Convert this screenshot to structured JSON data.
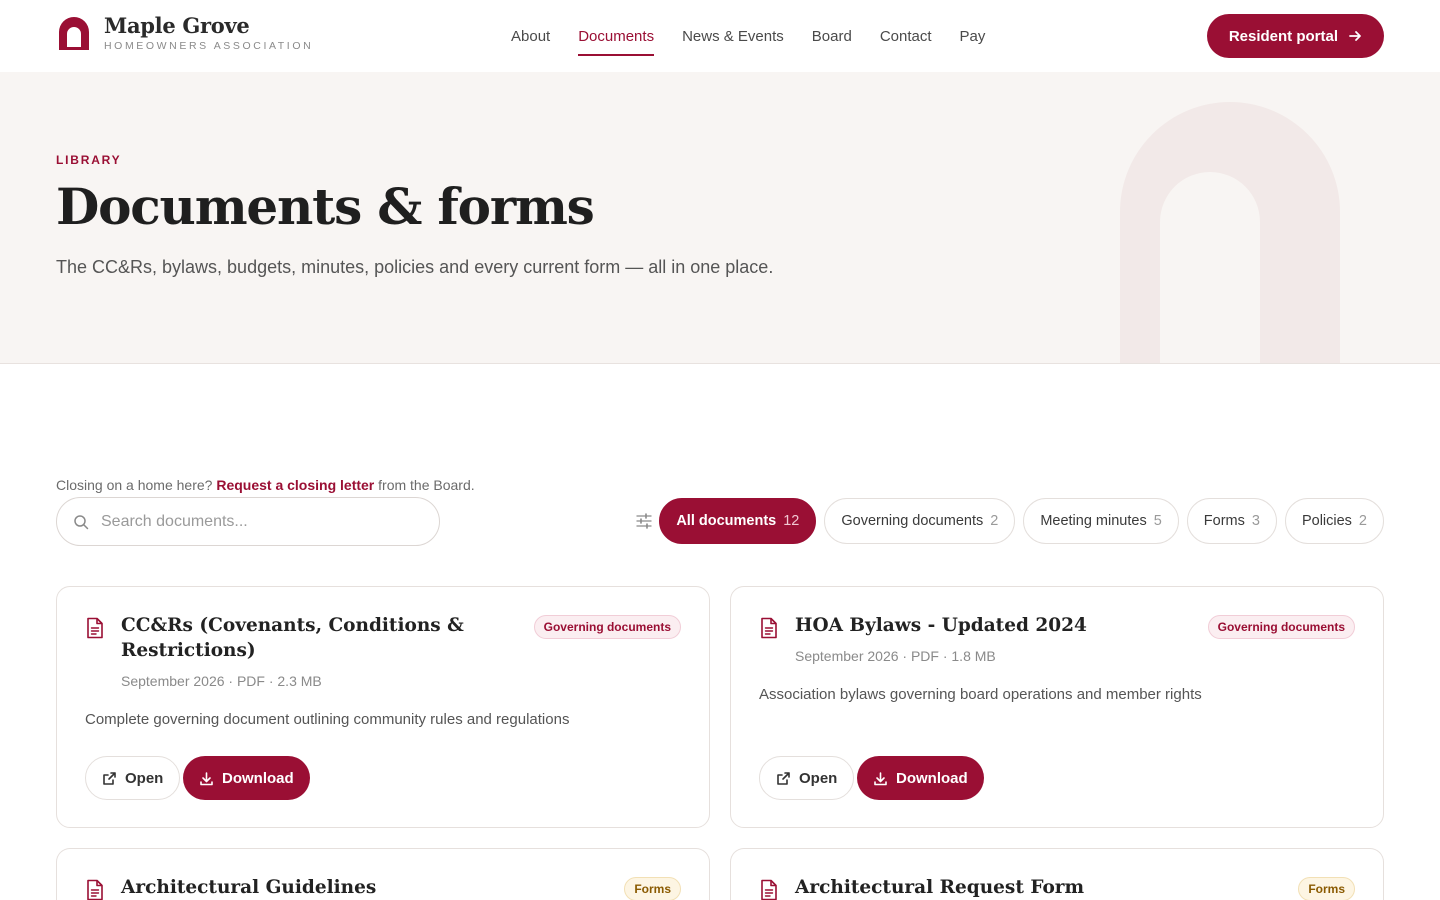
{
  "brand": {
    "name": "Maple Grove",
    "subtitle": "HOMEOWNERS ASSOCIATION",
    "accent": "#9a0f34"
  },
  "nav": {
    "items": [
      {
        "label": "About"
      },
      {
        "label": "Documents"
      },
      {
        "label": "News & Events"
      },
      {
        "label": "Board"
      },
      {
        "label": "Contact"
      },
      {
        "label": "Pay"
      }
    ],
    "active": "Documents",
    "portal_label": "Resident portal"
  },
  "hero": {
    "eyebrow": "LIBRARY",
    "title": "Documents & forms",
    "subtitle": "The CC&Rs, bylaws, budgets, minutes, policies and every current form — all in one place."
  },
  "closing": {
    "prefix": "Closing on a home here?",
    "link": "Request a closing letter",
    "suffix": "from the Board."
  },
  "search": {
    "placeholder": "Search documents..."
  },
  "filters": [
    {
      "label": "All documents",
      "count": "12"
    },
    {
      "label": "Governing documents",
      "count": "2"
    },
    {
      "label": "Meeting minutes",
      "count": "5"
    },
    {
      "label": "Forms",
      "count": "3"
    },
    {
      "label": "Policies",
      "count": "2"
    }
  ],
  "documents": [
    {
      "title": "CC&Rs (Covenants, Conditions & Restrictions)",
      "category": "Governing documents",
      "meta": "September 2026 · PDF · 2.3 MB",
      "description": "Complete governing document outlining community rules and regulations",
      "open_label": "Open",
      "download_label": "Download"
    },
    {
      "title": "HOA Bylaws - Updated 2024",
      "category": "Governing documents",
      "meta": "September 2026 · PDF · 1.8 MB",
      "description": "Association bylaws governing board operations and member rights",
      "open_label": "Open",
      "download_label": "Download"
    },
    {
      "title": "Architectural Guidelines",
      "category": "Forms"
    },
    {
      "title": "Architectural Request Form",
      "category": "Forms"
    }
  ]
}
